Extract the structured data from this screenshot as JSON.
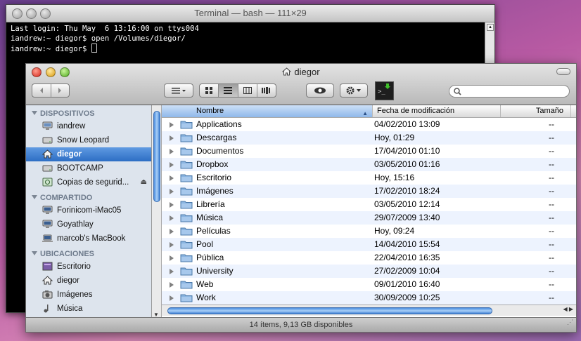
{
  "terminal": {
    "title": "Terminal — bash — 111×29",
    "lines": [
      "Last login: Thu May  6 13:16:00 on ttys004",
      "iandrew:~ diegor$ open /Volumes/diegor/",
      "iandrew:~ diegor$ "
    ]
  },
  "finder": {
    "title": "diegor",
    "toolbar": {
      "back_icon": "chevron-left-icon",
      "forward_icon": "chevron-right-icon",
      "search_placeholder": ""
    },
    "sidebar": {
      "sections": [
        {
          "label": "DISPOSITIVOS",
          "items": [
            {
              "label": "iandrew",
              "icon": "computer-icon"
            },
            {
              "label": "Snow Leopard",
              "icon": "drive-icon"
            },
            {
              "label": "diegor",
              "icon": "home-icon",
              "selected": true
            },
            {
              "label": "BOOTCAMP",
              "icon": "drive-icon"
            },
            {
              "label": "Copias de segurid...",
              "icon": "backup-drive-icon",
              "eject": true
            }
          ]
        },
        {
          "label": "COMPARTIDO",
          "items": [
            {
              "label": "Forinicom-iMac05",
              "icon": "network-computer-icon"
            },
            {
              "label": "Goyathlay",
              "icon": "network-computer-icon"
            },
            {
              "label": "marcob's MacBook",
              "icon": "network-computer-icon"
            }
          ]
        },
        {
          "label": "UBICACIONES",
          "items": [
            {
              "label": "Escritorio",
              "icon": "desktop-icon"
            },
            {
              "label": "diegor",
              "icon": "home-icon"
            },
            {
              "label": "Imágenes",
              "icon": "camera-icon"
            },
            {
              "label": "Música",
              "icon": "music-icon"
            }
          ]
        }
      ]
    },
    "columns": {
      "name": "Nombre",
      "date": "Fecha de modificación",
      "size": "Tamaño"
    },
    "rows": [
      {
        "name": "Applications",
        "date": "04/02/2010 13:09",
        "size": "--"
      },
      {
        "name": "Descargas",
        "date": "Hoy, 01:29",
        "size": "--"
      },
      {
        "name": "Documentos",
        "date": "17/04/2010 01:10",
        "size": "--"
      },
      {
        "name": "Dropbox",
        "date": "03/05/2010 01:16",
        "size": "--"
      },
      {
        "name": "Escritorio",
        "date": "Hoy, 15:16",
        "size": "--"
      },
      {
        "name": "Imágenes",
        "date": "17/02/2010 18:24",
        "size": "--"
      },
      {
        "name": "Librería",
        "date": "03/05/2010 12:14",
        "size": "--"
      },
      {
        "name": "Música",
        "date": "29/07/2009 13:40",
        "size": "--"
      },
      {
        "name": "Películas",
        "date": "Hoy, 09:24",
        "size": "--"
      },
      {
        "name": "Pool",
        "date": "14/04/2010 15:54",
        "size": "--"
      },
      {
        "name": "Pública",
        "date": "22/04/2010 16:35",
        "size": "--"
      },
      {
        "name": "University",
        "date": "27/02/2009 10:04",
        "size": "--"
      },
      {
        "name": "Web",
        "date": "09/01/2010 16:40",
        "size": "--"
      },
      {
        "name": "Work",
        "date": "30/09/2009 10:25",
        "size": "--"
      }
    ],
    "status": "14 ítems, 9,13 GB disponibles"
  }
}
